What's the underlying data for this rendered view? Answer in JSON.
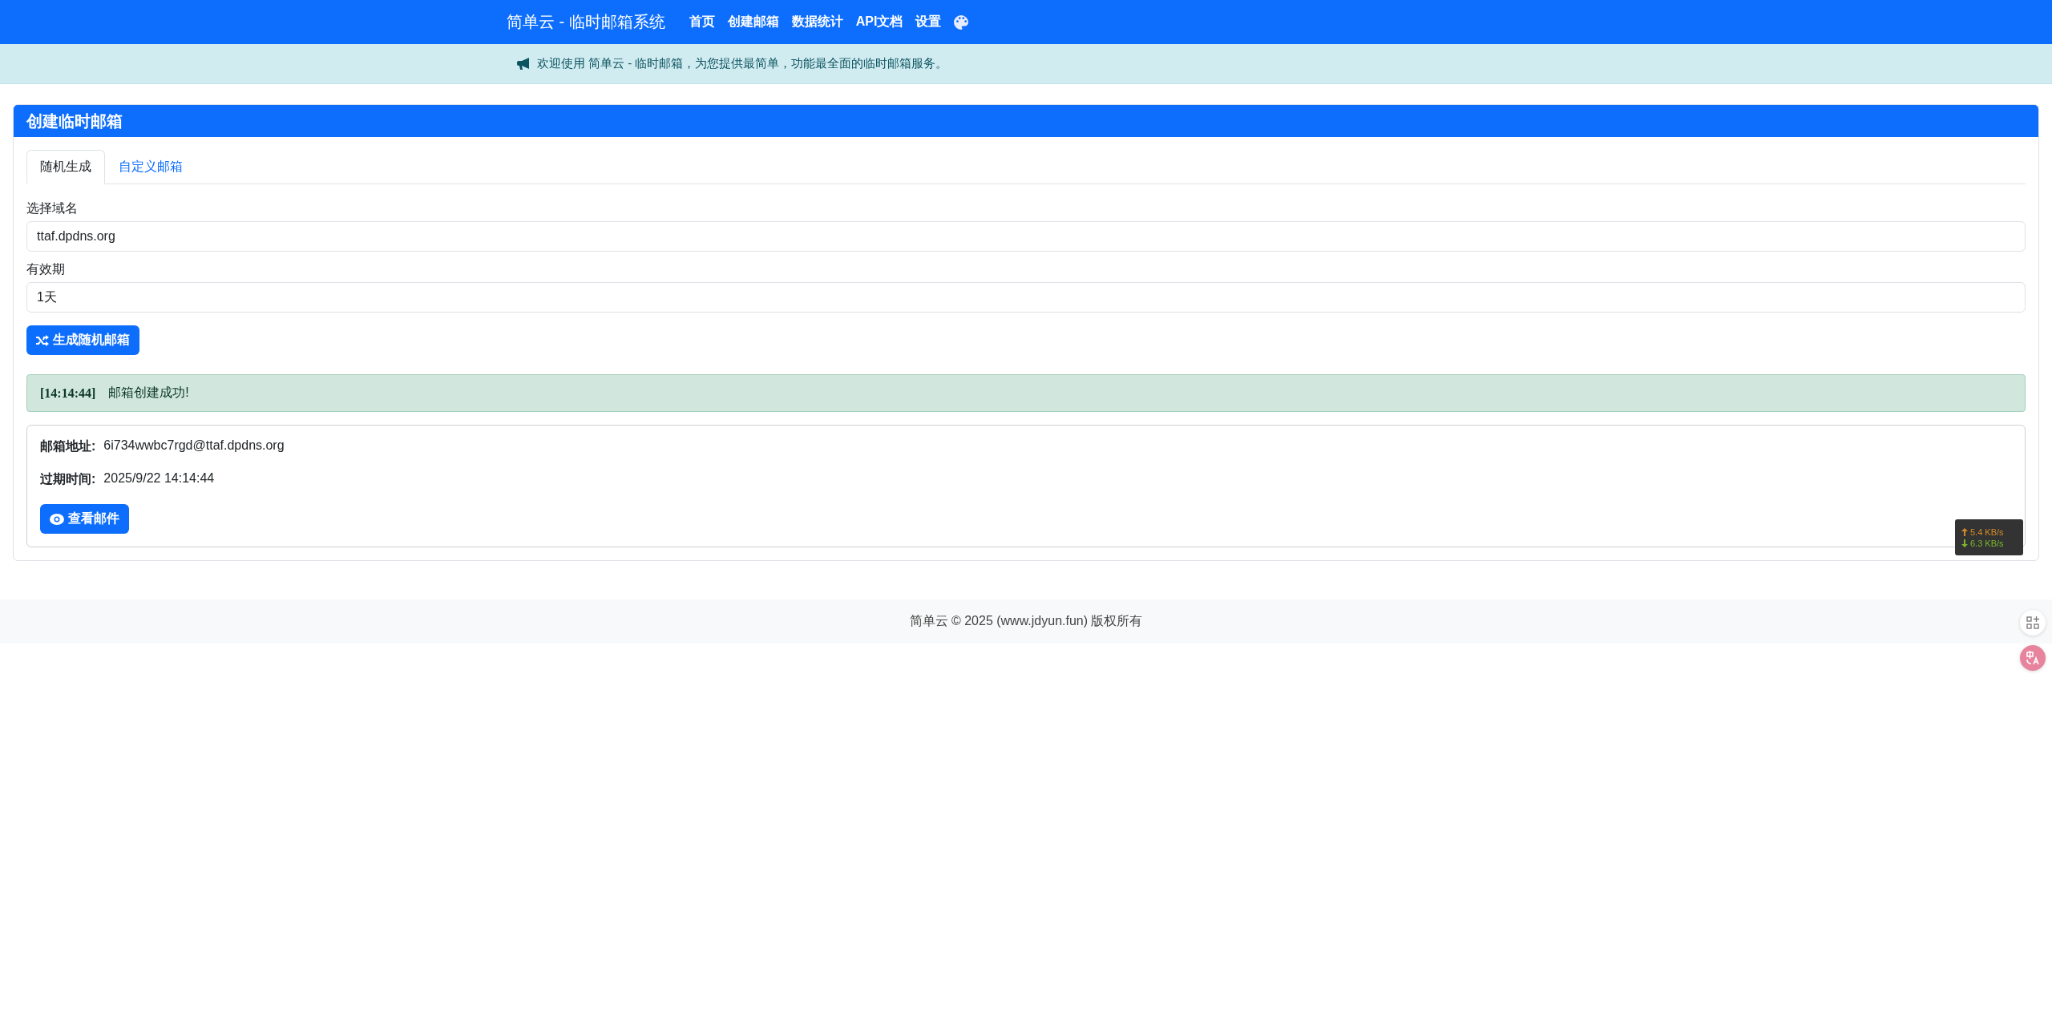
{
  "navbar": {
    "brand": "简单云 - 临时邮箱系统",
    "items": [
      {
        "label": "首页"
      },
      {
        "label": "创建邮箱"
      },
      {
        "label": "数据统计"
      },
      {
        "label": "API文档"
      },
      {
        "label": "设置"
      }
    ]
  },
  "announcement": "欢迎使用 简单云 - 临时邮箱，为您提供最简单，功能最全面的临时邮箱服务。",
  "card": {
    "title": "创建临时邮箱",
    "tabs": [
      {
        "label": "随机生成",
        "selected": true
      },
      {
        "label": "自定义邮箱",
        "selected": false
      }
    ],
    "fields": [
      {
        "label": "选择域名",
        "value": "ttaf.dpdns.org"
      },
      {
        "label": "有效期",
        "value": "1天"
      }
    ],
    "generate_button": "生成随机邮箱",
    "log": {
      "time": "[14:14:44]",
      "message": "邮箱创建成功!"
    },
    "result": {
      "rows": [
        {
          "label": "邮箱地址:",
          "value": "6i734wwbc7rgd@ttaf.dpdns.org"
        },
        {
          "label": "过期时间:",
          "value": "2025/9/22 14:14:44"
        }
      ],
      "button": "查看邮件"
    }
  },
  "footer": "简单云 © 2025 (www.jdyun.fun) 版权所有",
  "speed_widget": {
    "upload": "5.4 KB/s",
    "download": "6.3 KB/s"
  }
}
